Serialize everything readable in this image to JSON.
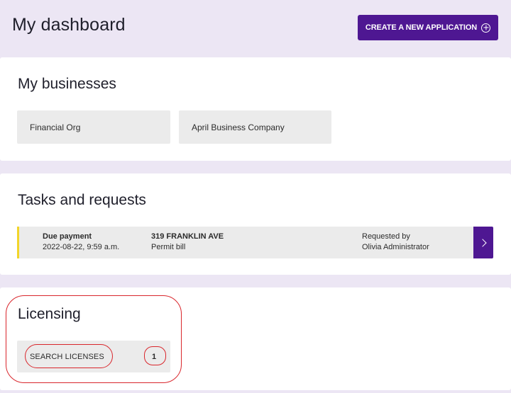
{
  "header": {
    "title": "My dashboard",
    "create_button_label": "CREATE A NEW APPLICATION",
    "create_button_icon": "plus-circle-icon"
  },
  "businesses": {
    "title": "My businesses",
    "items": [
      {
        "label": "Financial Org"
      },
      {
        "label": "April Business Company"
      }
    ]
  },
  "tasks": {
    "title": "Tasks and requests",
    "items": [
      {
        "type": "Due payment",
        "datetime": "2022-08-22, 9:59 a.m.",
        "address": "319 FRANKLIN AVE",
        "description": "Permit bill",
        "requested_by_label": "Requested by",
        "requested_by": "Olivia Administrator",
        "accent_color": "#f2d52a"
      }
    ]
  },
  "licensing": {
    "title": "Licensing",
    "search_label": "SEARCH LICENSES",
    "count": "1"
  },
  "colors": {
    "brand": "#4e1792",
    "background": "#ece6f4",
    "highlight": "#d9262c"
  }
}
